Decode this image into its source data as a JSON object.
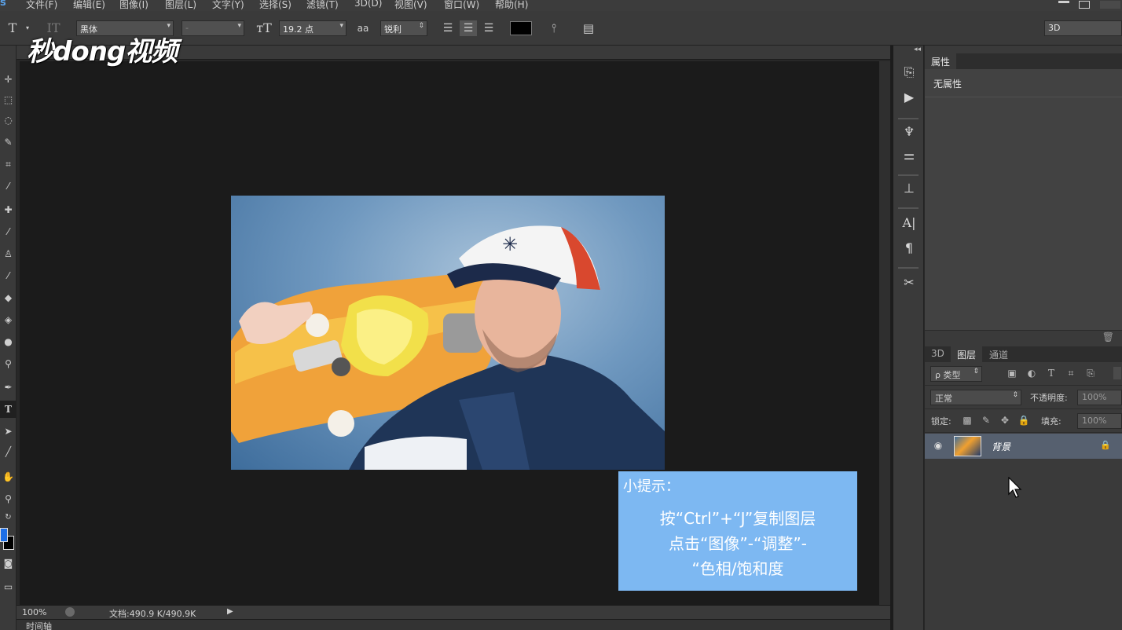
{
  "menubar": {
    "app_logo": "s",
    "items": [
      "文件(F)",
      "编辑(E)",
      "图像(I)",
      "图层(L)",
      "文字(Y)",
      "选择(S)",
      "滤镜(T)",
      "3D(D)",
      "视图(V)",
      "窗口(W)",
      "帮助(H)"
    ]
  },
  "options_bar": {
    "font_family": "黑体",
    "font_style": "-",
    "font_size": "19.2 点",
    "antialias_icon_label": "aa",
    "antialias": "锐利",
    "text_color": "#000000",
    "workspace": "3D"
  },
  "watermark": {
    "text": "秒dong视频"
  },
  "document": {
    "zoom": "100%",
    "doc_size": "文档:490.9 K/490.9K",
    "timeline_label": "时间轴"
  },
  "hint_box": {
    "title": "小提示：",
    "lines": [
      "按“Ctrl”+“J”复制图层",
      "点击“图像”-“调整”-",
      "“色相/饱和度"
    ],
    "background": "#7db8f2"
  },
  "properties_panel": {
    "tab": "属性",
    "empty_text": "无属性"
  },
  "layers_panel": {
    "tabs": [
      "3D",
      "图层",
      "通道"
    ],
    "filter_label": "ρ 类型",
    "blend_mode": "正常",
    "opacity_label": "不透明度:",
    "opacity_value": "100%",
    "lock_label": "锁定:",
    "fill_label": "填充:",
    "fill_value": "100%",
    "layers": [
      {
        "name": "背景",
        "visible": true,
        "locked": true,
        "selected": true
      }
    ]
  },
  "colors": {
    "foreground": "#1e6fe6",
    "background": "#000000",
    "selected_layer": "#56606f"
  }
}
